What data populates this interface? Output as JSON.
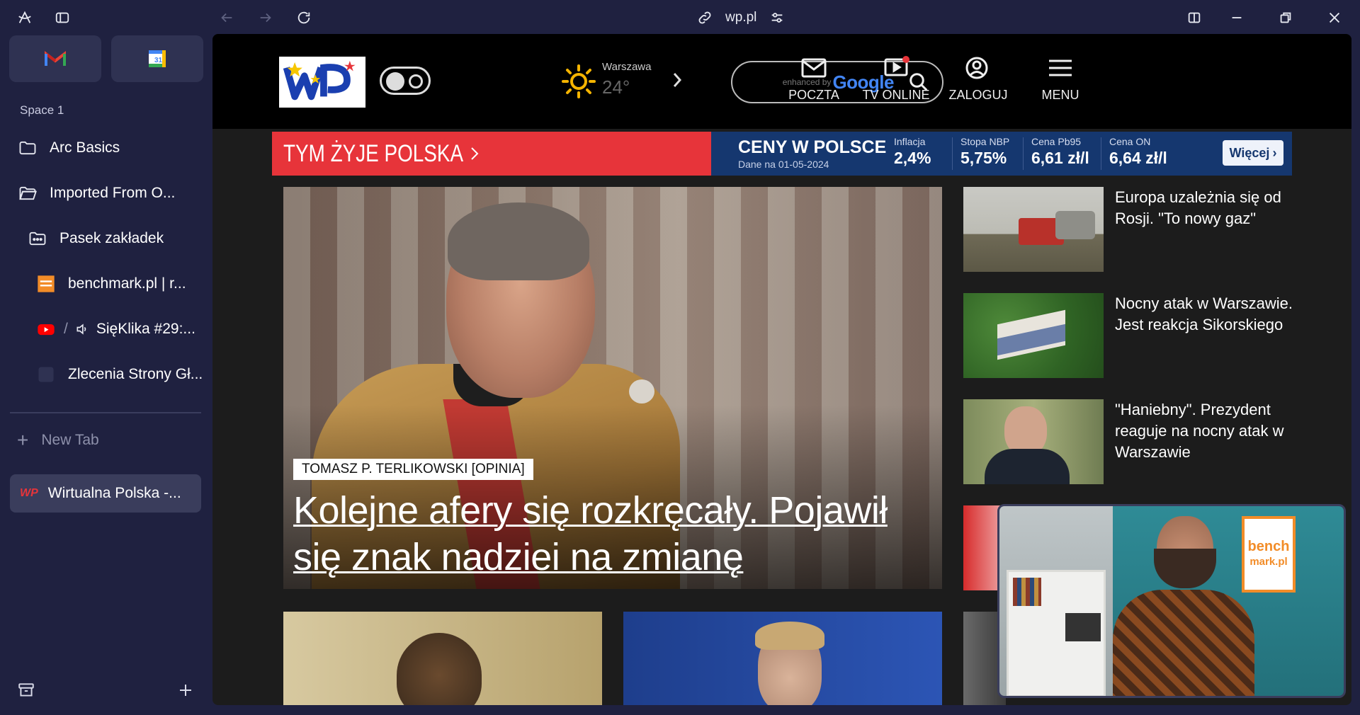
{
  "browser": {
    "url": "wp.pl"
  },
  "sidebar": {
    "space_label": "Space 1",
    "items": [
      {
        "label": "Arc Basics"
      },
      {
        "label": "Imported From O..."
      },
      {
        "label": "Pasek zakładek"
      },
      {
        "label": "benchmark.pl | r..."
      },
      {
        "label": "SięKlika #29:..."
      },
      {
        "label": "Zlecenia Strony Gł..."
      }
    ],
    "new_tab": "New Tab",
    "active_tab": "Wirtualna Polska -..."
  },
  "wp": {
    "weather": {
      "city": "Warszawa",
      "temp": "24°"
    },
    "search": {
      "enhanced": "enhanced by",
      "brand": "Google"
    },
    "nav": {
      "poczta": "POCZTA",
      "tv": "TV ONLINE",
      "zaloguj": "ZALOGUJ",
      "menu": "MENU"
    },
    "ticker": {
      "headline": "TYM ŻYJE POLSKA",
      "ceny_title": "CENY W POLSCE",
      "ceny_date": "Dane na 01-05-2024",
      "stats": [
        {
          "label": "Inflacja",
          "value": "2,4%"
        },
        {
          "label": "Stopa NBP",
          "value": "5,75%"
        },
        {
          "label": "Cena Pb95",
          "value": "6,61 zł/l"
        },
        {
          "label": "Cena ON",
          "value": "6,64 zł/l"
        }
      ],
      "more": "Więcej"
    },
    "hero": {
      "tag": "TOMASZ P. TERLIKOWSKI [OPINIA]",
      "title": "Kolejne afery się rozkręcały. Pojawił się znak nadziei na zmianę"
    },
    "news": [
      {
        "title": "Europa uzależnia się od Rosji. \"To nowy gaz\""
      },
      {
        "title": "Nocny atak w Warszawie. Jest reakcja Sikorskiego"
      },
      {
        "title": "\"Haniebny\". Prezydent reaguje na nocny atak w Warszawie"
      }
    ]
  },
  "pip": {
    "logo_line1": "bench",
    "logo_line2": "mark.pl"
  },
  "colors": {
    "sidebar_bg": "#1f2140",
    "ticker_red": "#e7343a",
    "ticker_blue": "#15376f",
    "weather_sun": "#f5b400"
  }
}
